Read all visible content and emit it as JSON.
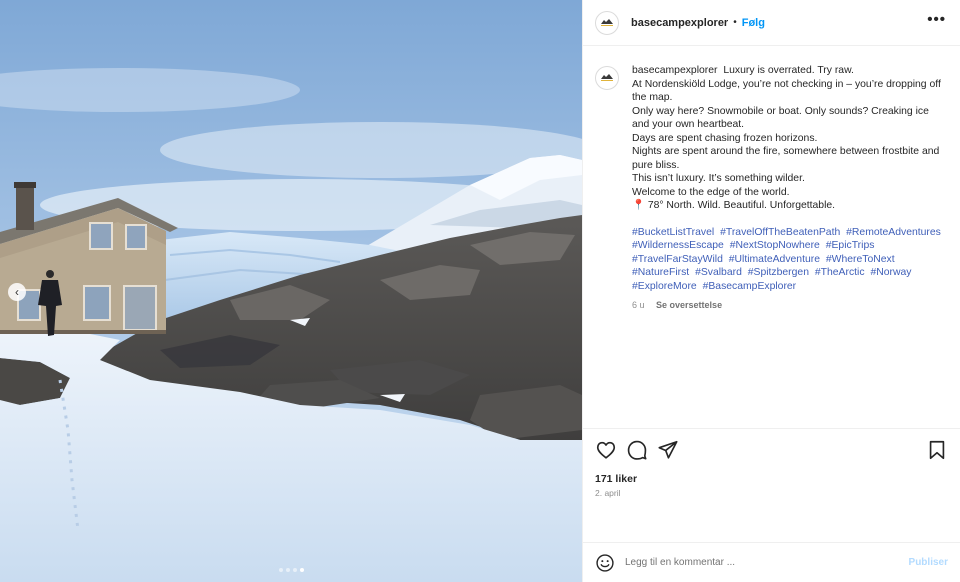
{
  "post": {
    "username": "basecampexplorer",
    "separator": "•",
    "follow_label": "Følg",
    "more_label": "•••",
    "caption_lines": [
      "At Nordenskiöld Lodge, you’re not checking in – you’re dropping off the map.",
      "Only way here? Snowmobile or boat. Only sounds? Creaking ice and your own heartbeat.",
      "",
      "Days are spent chasing frozen horizons.",
      "Nights are spent around the fire, somewhere between frostbite and pure bliss.",
      "",
      "This isn’t luxury. It’s something wilder.",
      "Welcome to the edge of the world.",
      "",
      "📍 78° North. Wild. Beautiful. Unforgettable."
    ],
    "caption_first": "Luxury is overrated. Try raw.",
    "hashtags": [
      "#BucketListTravel",
      "#TravelOffTheBeatenPath",
      "#RemoteAdventures",
      "#WildernessEscape",
      "#NextStopNowhere",
      "#EpicTrips",
      "#TravelFarStayWild",
      "#UltimateAdventure",
      "#WhereToNext",
      "#NatureFirst",
      "#Svalbard",
      "#Spitzbergen",
      "#TheArctic",
      "#Norway",
      "#ExploreMore",
      "#BasecampExplorer"
    ],
    "age": "6 u",
    "translate_label": "Se oversettelse",
    "likes": "171 liker",
    "date": "2. april",
    "comment_placeholder": "Legg til en kommentar ...",
    "publish_label": "Publiser"
  },
  "media": {
    "prev_label": "‹",
    "slide_count": 4,
    "active_slide": 4
  },
  "icons": {
    "like": "heart-icon",
    "comment": "comment-bubble-icon",
    "share": "paper-plane-icon",
    "save": "bookmark-icon",
    "emoji": "smiley-icon"
  },
  "colors": {
    "follow": "#0095f6",
    "hashtag": "#3f5fb8",
    "publish_disabled": "#b3dbff"
  }
}
